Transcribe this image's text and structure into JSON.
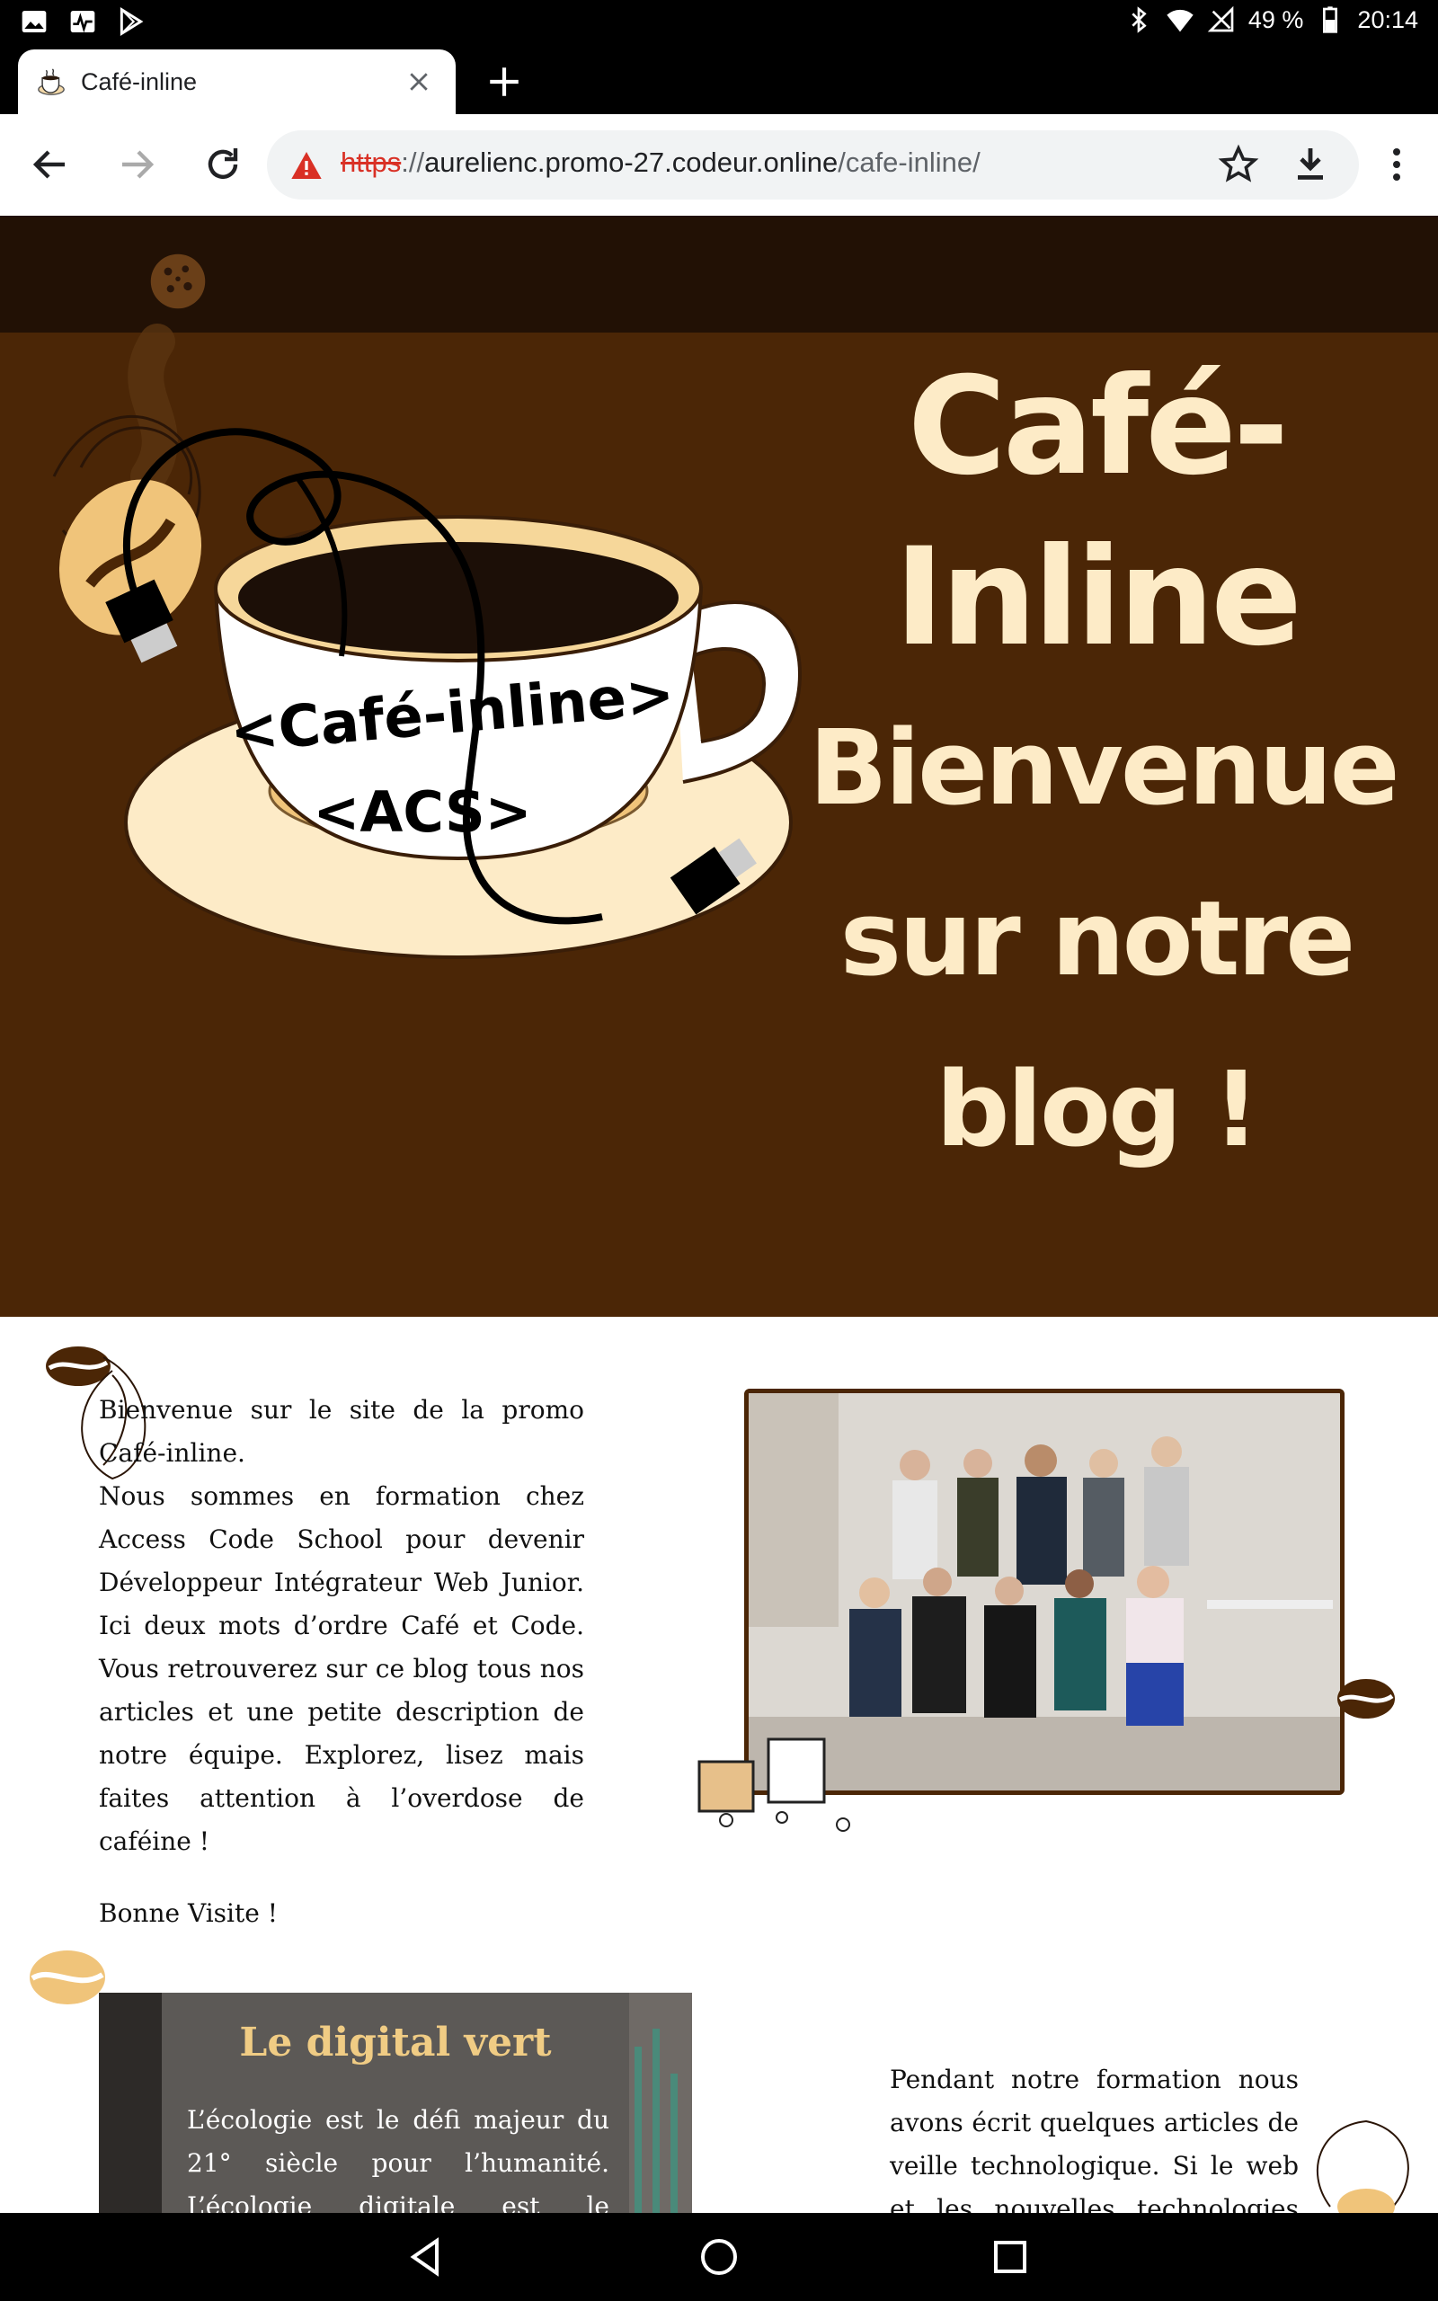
{
  "status_bar": {
    "battery": "49 %",
    "time": "20:14"
  },
  "browser": {
    "tab_title": "Café-inline",
    "url": {
      "scheme": "https",
      "separator": "://",
      "host": "aurelienc.promo-27.codeur.online",
      "path": "/cafe-inline/"
    }
  },
  "hero": {
    "cup_text_line1": "<Café-inline>",
    "cup_text_line2": "<ACS>",
    "title_line1": "Café-",
    "title_line2": "Inline",
    "title_line3": "Bienvenue",
    "title_line4": "sur notre",
    "title_line5": "blog !"
  },
  "intro": {
    "paragraph1": "Bienvenue sur le site de la promo Café-inline.",
    "paragraph2": "Nous sommes en formation chez Access Code School pour devenir Développeur Intégrateur Web Junior. Ici deux mots d’ordre Café et Code. Vous retrouverez sur ce blog tous nos articles et une petite description de notre équipe. Explorez, lisez mais faites attention à l’overdose de caféine !",
    "greeting": "Bonne Visite !"
  },
  "article": {
    "title": "Le digital vert",
    "excerpt": "L’écologie est le défi majeur du 21° siècle pour l’humanité. L’écologie digitale est le prochain … Depuis"
  },
  "articles_intro": {
    "text": "Pendant notre formation nous avons écrit quelques articles de veille technologique. Si le web et les nouvelles technologies vous"
  },
  "colors": {
    "hero_bg": "#4b2606",
    "nav_bg": "#221105",
    "cream": "#fdebc7",
    "accent_gold": "#f0cc84"
  }
}
